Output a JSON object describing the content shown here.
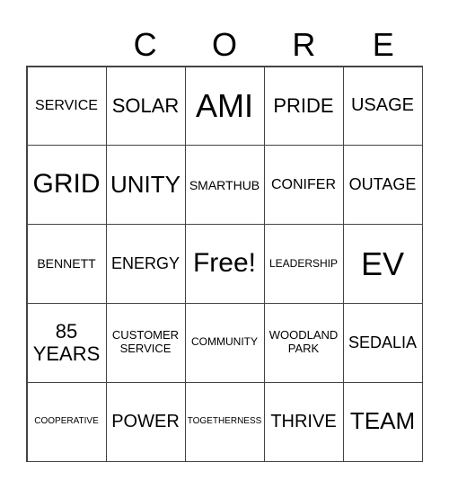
{
  "header": {
    "letters": [
      "",
      "C",
      "O",
      "R",
      "E"
    ]
  },
  "cells": [
    [
      "SERVICE",
      "SOLAR",
      "AMI",
      "PRIDE",
      "USAGE"
    ],
    [
      "GRID",
      "UNITY",
      "SMARTHUB",
      "CONIFER",
      "OUTAGE"
    ],
    [
      "BENNETT",
      "ENERGY",
      "Free!",
      "LEADERSHIP",
      "EV"
    ],
    [
      "85 YEARS",
      "CUSTOMER SERVICE",
      "COMMUNITY",
      "WOODLAND PARK",
      "SEDALIA"
    ],
    [
      "COOPERATIVE",
      "POWER",
      "TOGETHERNESS",
      "THRIVE",
      "TEAM"
    ]
  ]
}
